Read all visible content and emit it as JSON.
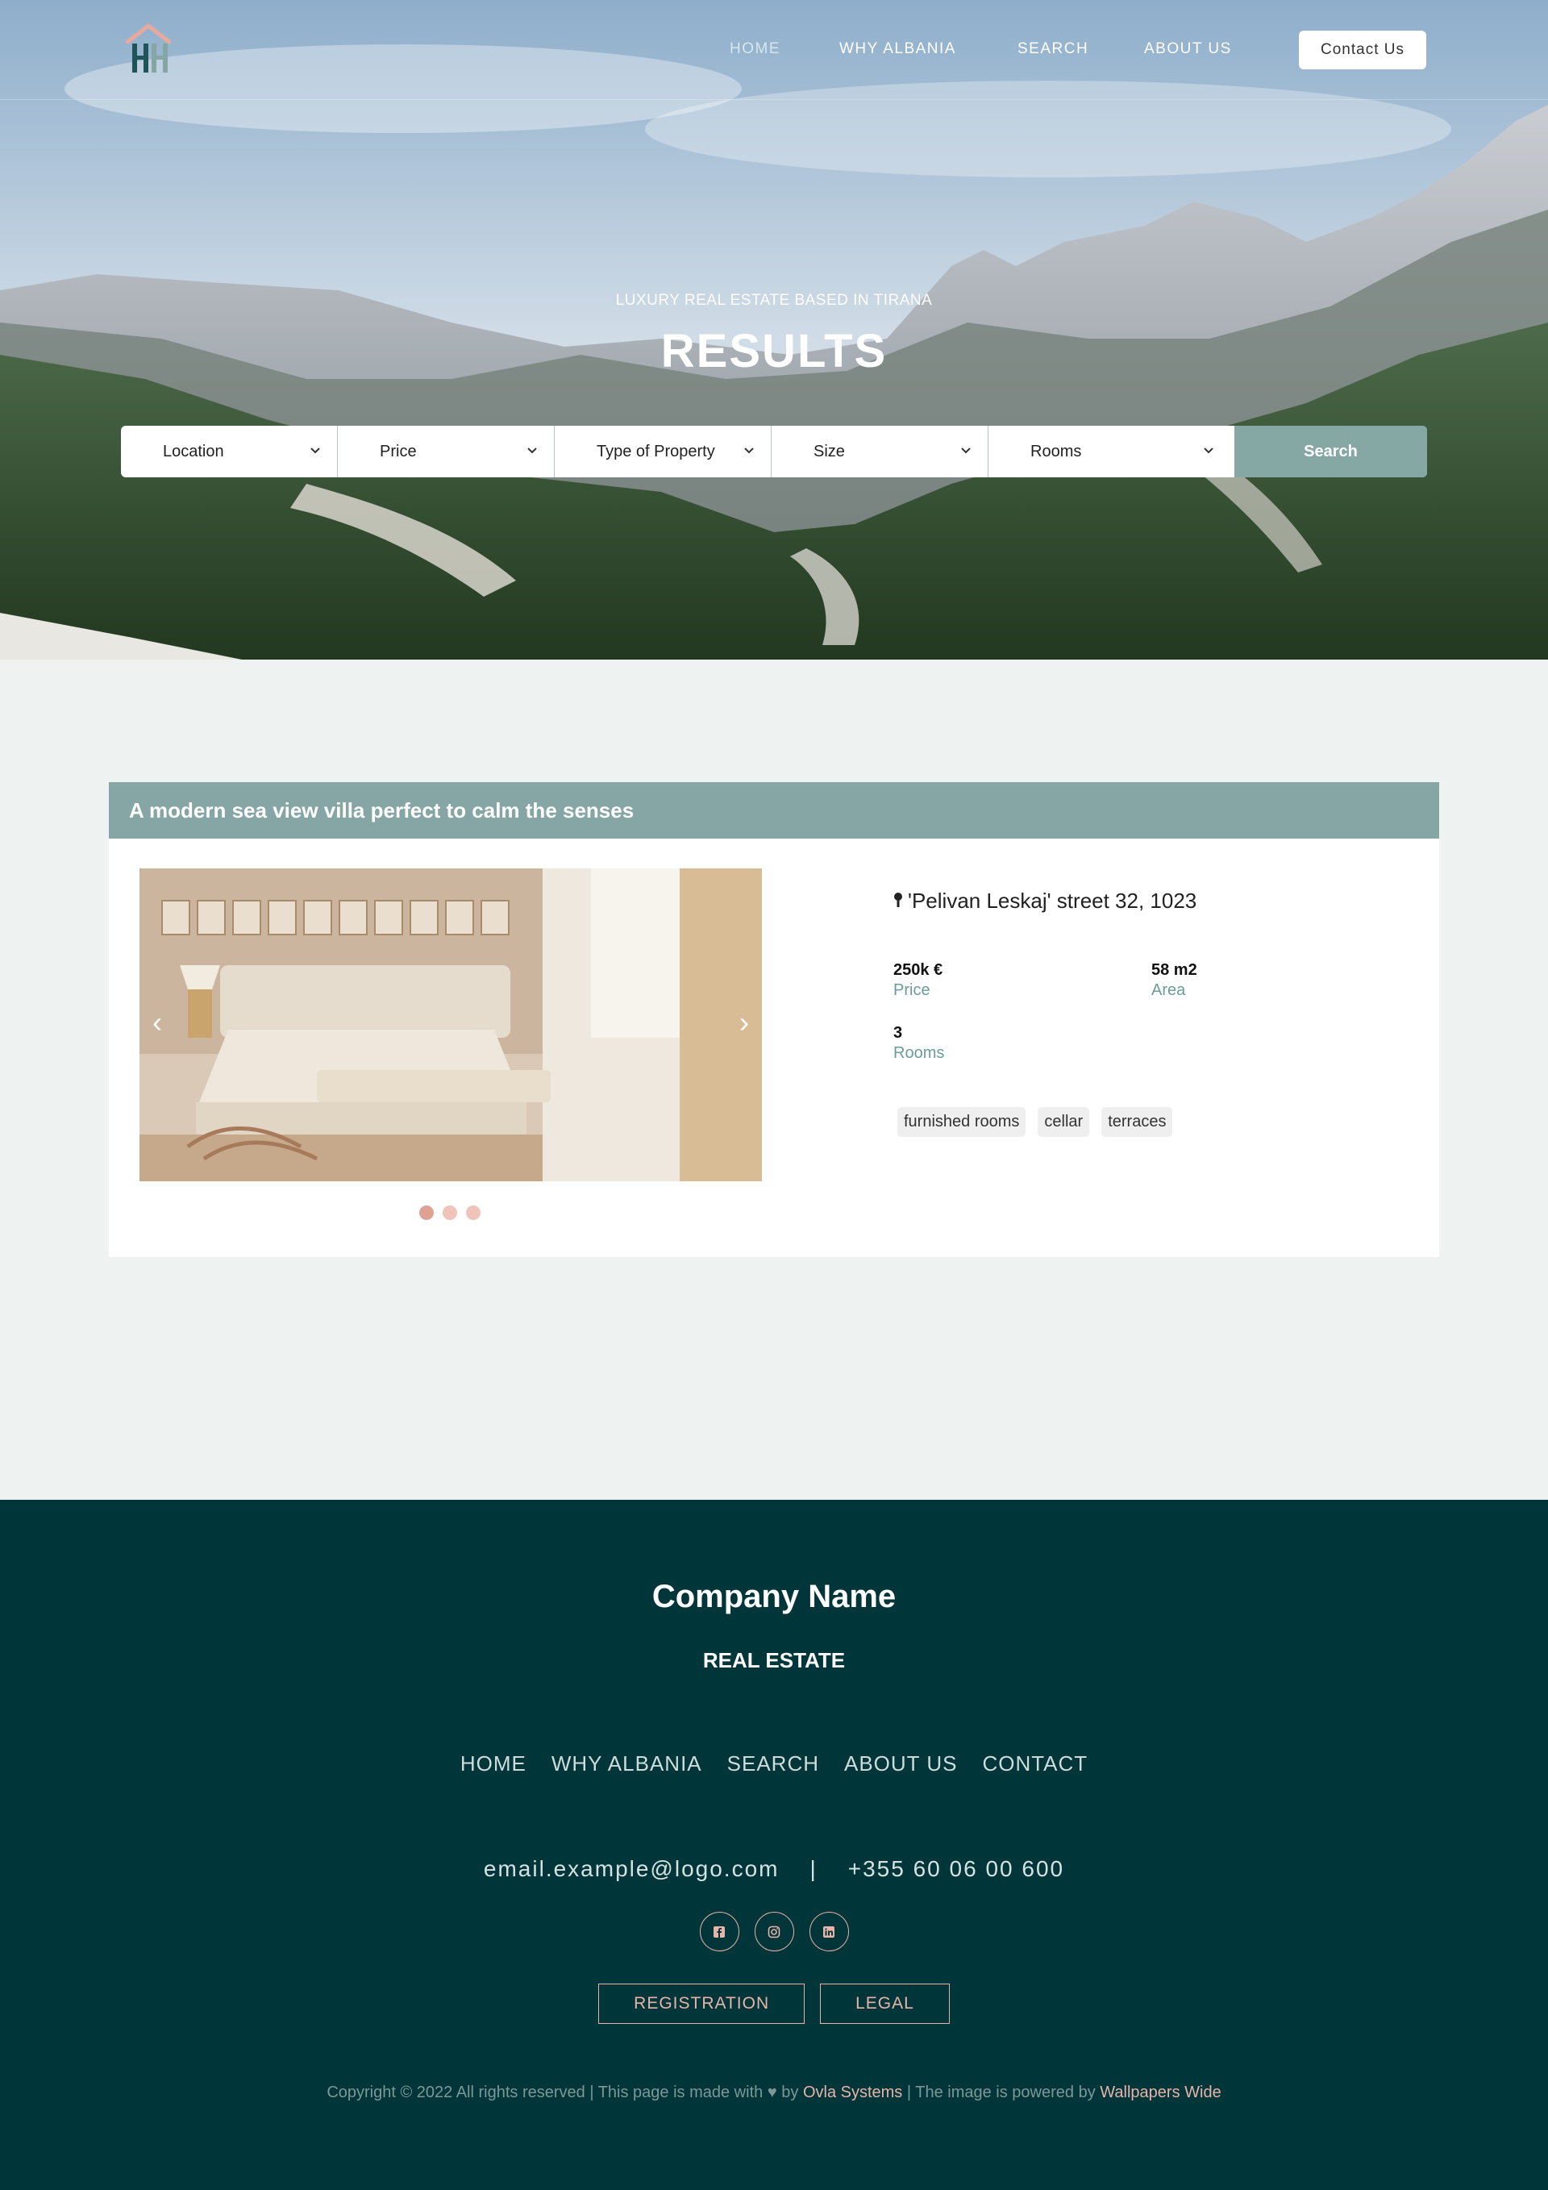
{
  "nav": {
    "links": [
      "HOME",
      "WHY ALBANIA",
      "SEARCH",
      "ABOUT US"
    ],
    "contact_button": "Contact Us"
  },
  "hero": {
    "subtitle": "LUXURY REAL ESTATE BASED IN TIRANA",
    "title": "RESULTS"
  },
  "search": {
    "filters": [
      "Location",
      "Price",
      "Type of Property",
      "Size",
      "Rooms"
    ],
    "button": "Search"
  },
  "listing": {
    "title": "A modern sea view villa perfect to calm the senses",
    "address": "'Pelivan Leskaj' street 32, 1023",
    "price_value": "250k €",
    "price_label": "Price",
    "area_value": "58 m2",
    "area_label": "Area",
    "rooms_value": "3",
    "rooms_label": "Rooms",
    "tags": [
      "furnished rooms",
      "cellar",
      "terraces"
    ],
    "carousel": {
      "prev": "‹",
      "next": "›",
      "slides": 3,
      "active": 1
    }
  },
  "footer": {
    "company": "Company Name",
    "subtitle": "REAL ESTATE",
    "links": [
      "HOME",
      "WHY ALBANIA",
      "SEARCH",
      "ABOUT US",
      "CONTACT"
    ],
    "email": "email.example@logo.com",
    "separator": "|",
    "phone": "+355 60 06 00 600",
    "socials": [
      "facebook-icon",
      "instagram-icon",
      "linkedin-icon"
    ],
    "buttons": [
      "REGISTRATION",
      "LEGAL"
    ],
    "copyright_pre": "Copyright © 2022 All rights reserved | This page is made with",
    "copyright_by": "by",
    "copyright_company": "Ovla Systems",
    "copyright_mid": "| The image is powered by",
    "copyright_source": "Wallpapers Wide"
  },
  "colors": {
    "accent": "#85a6a5",
    "footer_bg": "#003539",
    "highlight": "#e8b3a8",
    "page_bg": "#eef3f2"
  }
}
